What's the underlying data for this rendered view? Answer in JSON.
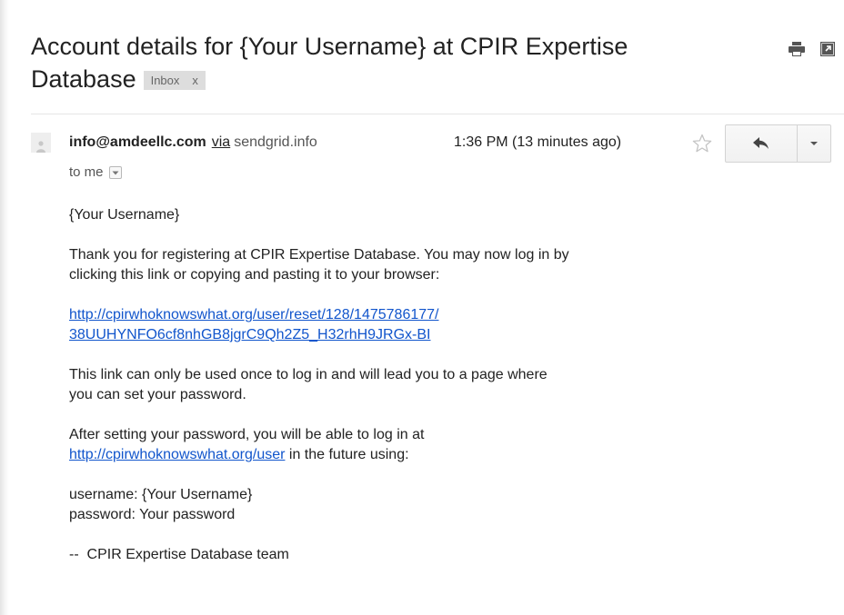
{
  "subject": {
    "title": "Account details for {Your Username} at CPIR Expertise Database",
    "label": "Inbox",
    "label_close": "x"
  },
  "top_actions": {
    "print_icon": "printer-icon",
    "new_window_icon": "open-in-new-window-icon"
  },
  "message": {
    "sender_email": "info@amdeellc.com",
    "via_text": "via",
    "via_domain": "sendgrid.info",
    "timestamp": "1:36 PM (13 minutes ago)",
    "star_icon": "star-outline-icon",
    "reply_icon": "reply-icon",
    "more_icon": "chevron-down-icon",
    "recipient": "to me",
    "avatar_icon": "person-silhouette-icon"
  },
  "body": {
    "greeting": "{Your Username}",
    "intro_line1": "Thank you for registering at CPIR Expertise Database. You may now log in by",
    "intro_line2": "clicking this link or copying and pasting it to your browser:",
    "reset_link_line1": "http://cpirwhoknowswhat.org/user/reset/128/1475786177/",
    "reset_link_line2": "38UUHYNFO6cf8nhGB8jgrC9Qh2Z5_H32rhH9JRGx-BI",
    "once_line1": "This link can only be used once to log in and will lead you to a page where",
    "once_line2": "you can set your password.",
    "after_line1": "After setting your password, you will be able to log in at",
    "user_link": "http://cpirwhoknowswhat.org/user",
    "after_line2_suffix": " in the future using:",
    "username_line": "username: {Your Username}",
    "password_line": "password: Your password",
    "signature": "--  CPIR Expertise Database team"
  },
  "colors": {
    "link": "#1155cc",
    "label_bg": "#dddddd",
    "text": "#222222"
  }
}
